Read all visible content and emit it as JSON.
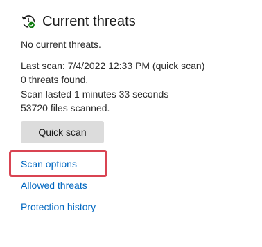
{
  "header": {
    "icon": "virus-scan-check-icon",
    "title": "Current threats"
  },
  "status": {
    "no_threats": "No current threats.",
    "last_scan": "Last scan: 7/4/2022 12:33 PM (quick scan)",
    "threats_found": "0 threats found.",
    "scan_duration": "Scan lasted 1 minutes 33 seconds",
    "files_scanned": "53720 files scanned."
  },
  "actions": {
    "quick_scan_label": "Quick scan"
  },
  "links": {
    "scan_options": "Scan options",
    "allowed_threats": "Allowed threats",
    "protection_history": "Protection history"
  },
  "colors": {
    "link": "#0067c0",
    "button_bg": "#dcdcdc",
    "highlight": "#d94452",
    "check_badge": "#107c10"
  }
}
